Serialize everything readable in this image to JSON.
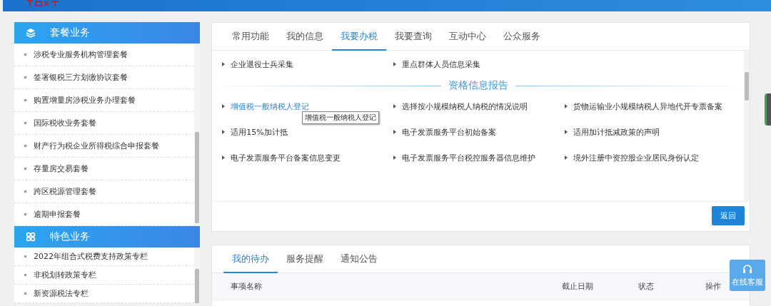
{
  "left_panels": [
    {
      "title": "套餐业务",
      "items": [
        "涉税专业服务机构管理套餐",
        "签署银税三方划缴协议套餐",
        "购置增量房涉税业务办理套餐",
        "国际税收业务套餐",
        "财产行为税企业所得税综合申报套餐",
        "存量房交易套餐",
        "跨区税源管理套餐",
        "逾期申报套餐"
      ]
    },
    {
      "title": "特色业务",
      "items": [
        "2022年组合式税费支持政策专栏",
        "非税划转政策专栏",
        "新资源税法专栏"
      ]
    }
  ],
  "main_tabs": [
    {
      "label": "常用功能",
      "selected": false
    },
    {
      "label": "我的信息",
      "selected": false
    },
    {
      "label": "我要办税",
      "selected": true
    },
    {
      "label": "我要查询",
      "selected": false
    },
    {
      "label": "互动中心",
      "selected": false
    },
    {
      "label": "公众服务",
      "selected": false
    }
  ],
  "top_links": [
    {
      "label": "企业退役士兵采集",
      "hovered": false
    },
    {
      "label": "重点群体人员信息采集",
      "hovered": false
    }
  ],
  "section_title": "资格信息报告",
  "section_links": [
    {
      "label": "增值税一般纳税人登记",
      "hovered": true
    },
    {
      "label": "选择按小规模纳税人纳税的情况说明",
      "hovered": false
    },
    {
      "label": "货物运输业小规模纳税人异地代开专票备案",
      "hovered": false
    },
    {
      "label": "适用15%加计抵",
      "hovered": false
    },
    {
      "label": "电子发票服务平台初始备案",
      "hovered": false
    },
    {
      "label": "适用加计抵减政策的声明",
      "hovered": false
    },
    {
      "label": "电子发票服务平台备案信息变更",
      "hovered": false
    },
    {
      "label": "电子发票服务平台税控服务器信息维护",
      "hovered": false
    },
    {
      "label": "境外注册中资控股企业居民身份认定",
      "hovered": false
    }
  ],
  "tooltip": "增值税一般纳税人登记",
  "back_button": "返回",
  "bottom_tabs": [
    {
      "label": "我的待办",
      "selected": true
    },
    {
      "label": "服务提醒",
      "selected": false
    },
    {
      "label": "通知公告",
      "selected": false
    }
  ],
  "table": {
    "columns": [
      "事项名称",
      "截止日期",
      "状态",
      "操作"
    ]
  },
  "support_button": "在线客服"
}
